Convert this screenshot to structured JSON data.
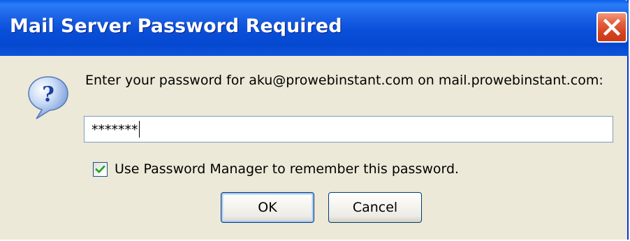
{
  "dialog": {
    "title": "Mail Server Password Required",
    "prompt": "Enter your password for aku@prowebinstant.com on mail.prowebinstant.com:",
    "password_value": "*******",
    "remember_checkbox": {
      "label": "Use Password Manager to remember this password.",
      "checked": true
    },
    "ok_label": "OK",
    "cancel_label": "Cancel",
    "icon": "question-icon"
  },
  "colors": {
    "titlebar": "#0A4FD9",
    "dialog_background": "#ECE9D8",
    "close_button": "#D5431D",
    "input_border": "#7F9DB9"
  }
}
